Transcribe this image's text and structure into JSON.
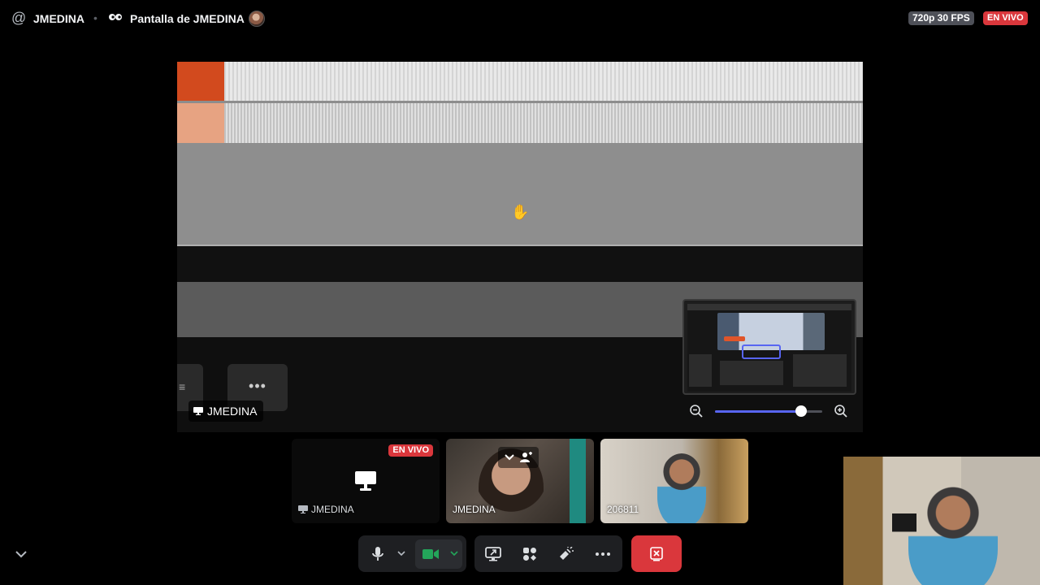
{
  "topbar": {
    "channel_icon": "at-icon",
    "channel_name": "JMEDINA",
    "stream_icon": "stream-eyes-icon",
    "stream_title": "Pantalla de JMEDINA",
    "quality": "720p 30 FPS",
    "live_badge": "EN VIVO"
  },
  "main_stream": {
    "label": "JMEDINA",
    "label_icon": "monitor-icon",
    "more_button": "•••",
    "side_button": "≡",
    "minimap": {
      "zoom_level": 0.8
    }
  },
  "participants": [
    {
      "name": "JMEDINA",
      "type": "screen-share",
      "live_badge": "EN VIVO"
    },
    {
      "name": "JMEDINA",
      "type": "camera"
    },
    {
      "name": "206811",
      "type": "camera"
    }
  ],
  "controls": {
    "mic": "microphone-icon",
    "mic_options": "chevron-down-icon",
    "camera": "camera-icon",
    "camera_options": "chevron-down-icon",
    "share_screen": "share-screen-icon",
    "activities": "activities-icon",
    "soundboard": "soundboard-icon",
    "more": "more-icon",
    "leave": "leave-call-icon"
  },
  "colors": {
    "live_red": "#da373c",
    "accent_blurple": "#5865f2",
    "camera_green": "#23a55a",
    "control_bg": "#1e1f22"
  }
}
